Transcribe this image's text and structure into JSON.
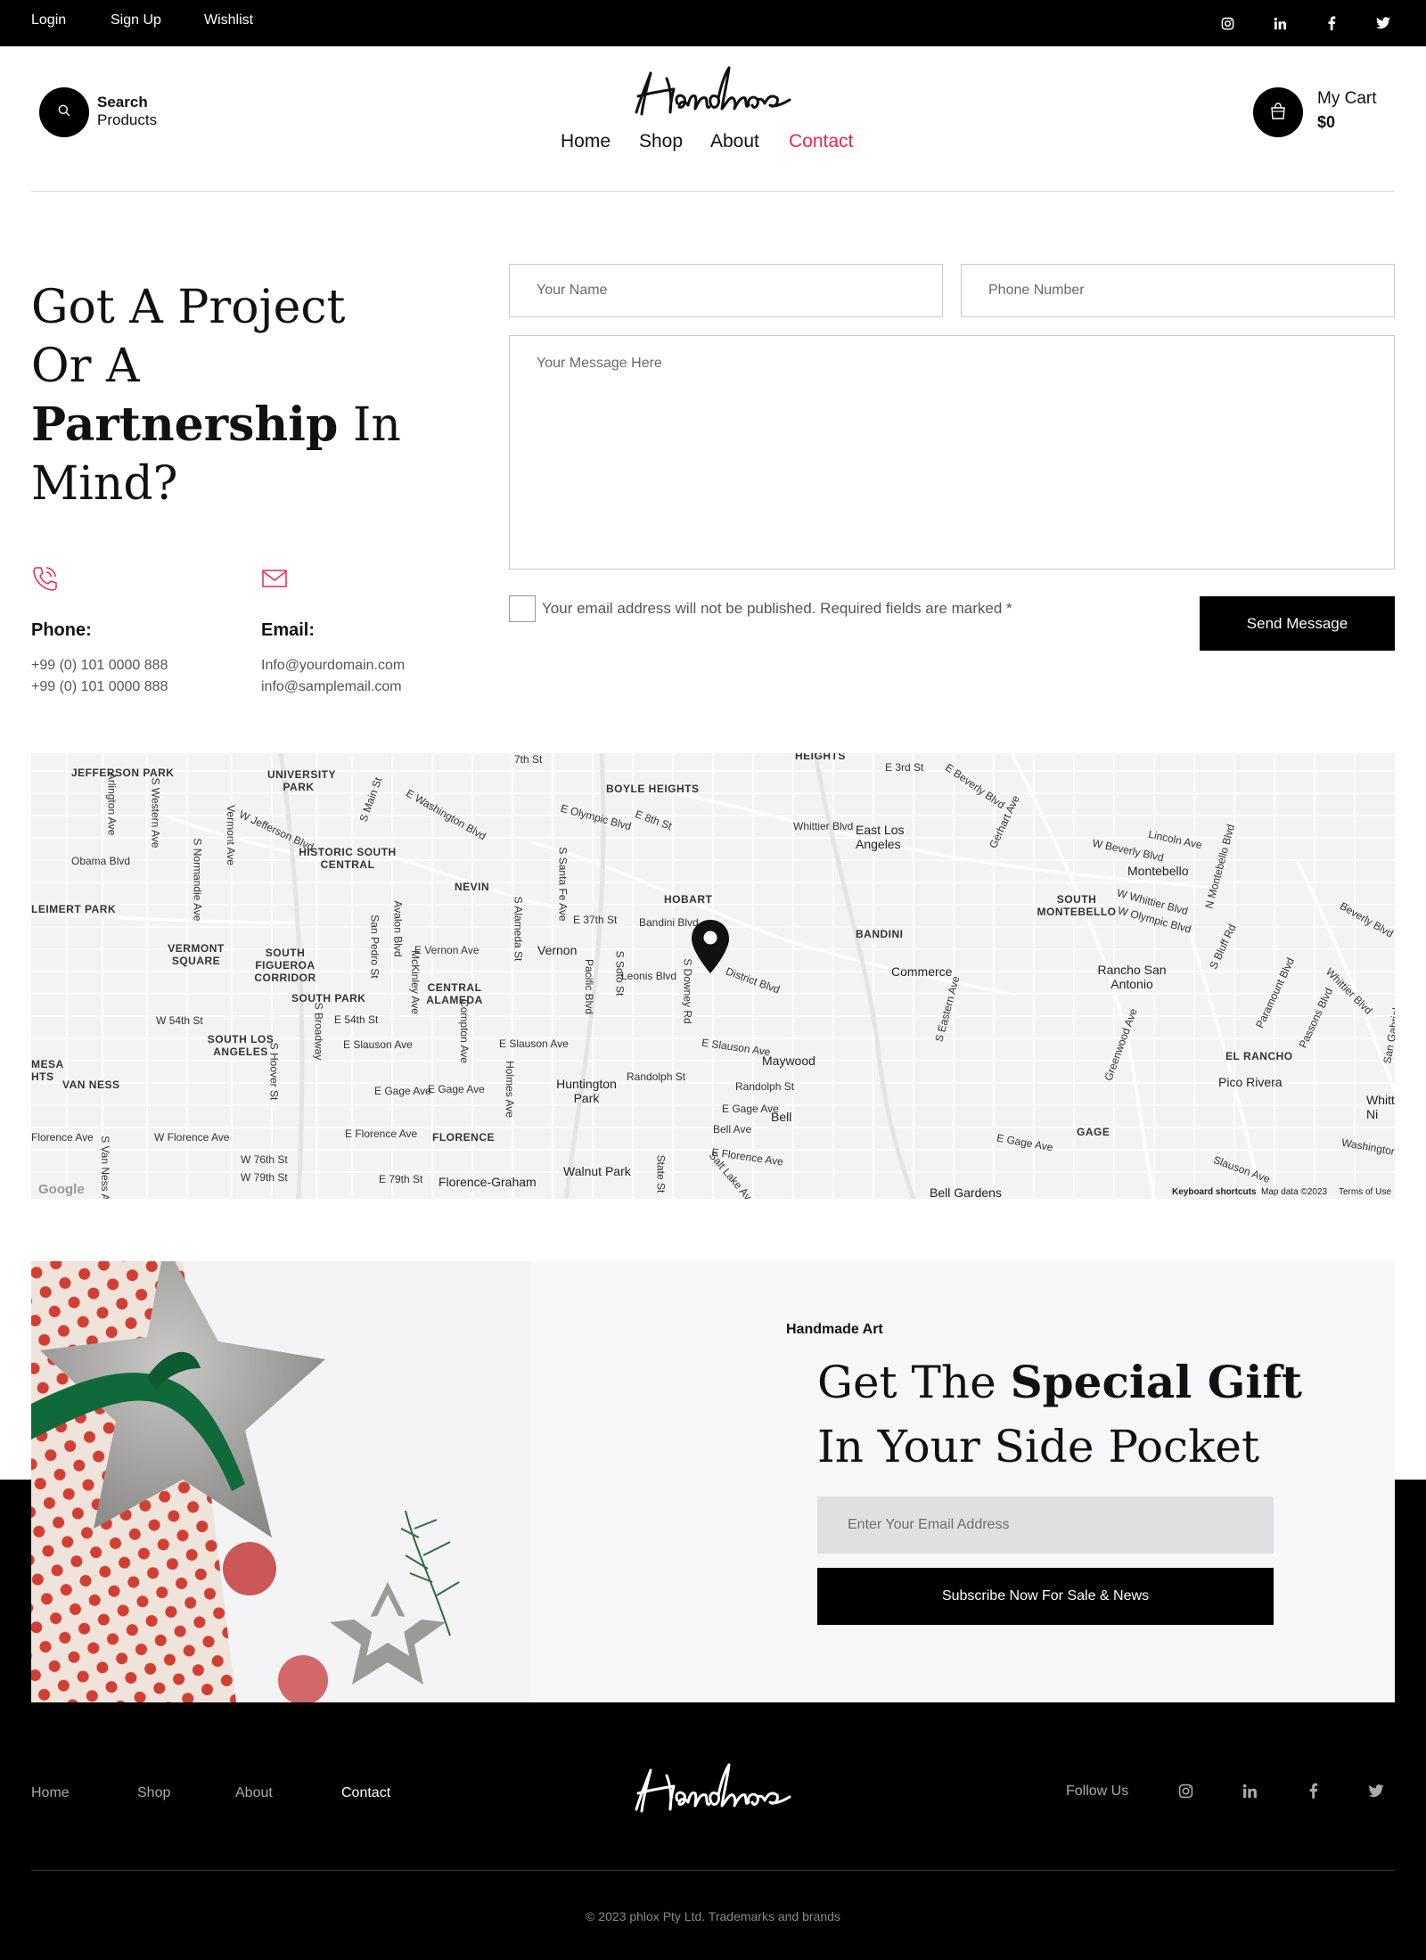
{
  "topbar": {
    "links": [
      "Login",
      "Sign Up",
      "Wishlist"
    ],
    "social_icons": [
      "instagram-icon",
      "linkedin-icon",
      "facebook-icon",
      "twitter-icon"
    ]
  },
  "header": {
    "search_label": "Search",
    "search_sublabel": "Products",
    "logo_text": "Handmade",
    "nav": [
      "Home",
      "Shop",
      "About",
      "Contact"
    ],
    "active_nav": "Contact",
    "cart_label": "My Cart",
    "cart_amount": "$0"
  },
  "contact": {
    "headline_line1": "Got A Project",
    "headline_line2": "Or A",
    "headline_bold": "Partnership",
    "headline_line3_rest": "In",
    "headline_line4": "Mind?",
    "phone_title": "Phone:",
    "phone_lines": [
      "+99 (0) 101 0000 888",
      "+99 (0) 101 0000 888"
    ],
    "email_title": "Email:",
    "email_lines": [
      "Info@yourdomain.com",
      "info@samplemail.com"
    ],
    "accent_color": "#e8294c"
  },
  "form": {
    "name_placeholder": "Your Name",
    "phone_placeholder": "Phone Number",
    "message_placeholder": "Your Message Here",
    "consent_text": "Your email address will not be published. Required fields are marked *",
    "consent_checked": false,
    "send_label": "Send Message"
  },
  "map": {
    "labels": {
      "jefferson_park": "JEFFERSON PARK",
      "university_park": "UNIVERSITY PARK",
      "boyle_heights": "BOYLE HEIGHTS",
      "heights": "HEIGHTS",
      "east_los_angeles": "East Los Angeles",
      "montebello": "Montebello",
      "south_montebello": "SOUTH MONTEBELLO",
      "historic_south_central": "HISTORIC SOUTH CENTRAL",
      "nevin": "NEVIN",
      "hobart": "HOBART",
      "bandini": "BANDINI",
      "leimert_park": "LEIMERT PARK",
      "vermont_square": "VERMONT SQUARE",
      "south_figueroa_corridor": "SOUTH FIGUEROA CORRIDOR",
      "vernon": "Vernon",
      "commerce": "Commerce",
      "rancho_san_antonio": "Rancho San Antonio",
      "central_alameda": "CENTRAL ALAMEDA",
      "south_park": "SOUTH PARK",
      "south_los_angeles": "SOUTH LOS ANGELES",
      "mesa_heights": "MESA HTS",
      "van_ness": "VAN NESS",
      "maywood": "Maywood",
      "el_rancho": "EL RANCHO",
      "pico_rivera": "Pico Rivera",
      "huntington_park": "Huntington Park",
      "bell": "Bell",
      "gage": "GAGE",
      "florence": "FLORENCE",
      "walnut_park": "Walnut Park",
      "florence_graham": "Florence-Graham",
      "bell_gardens": "Bell Gardens",
      "whittier_abbr": "Whitt Ni",
      "streets": [
        "7th St",
        "E 3rd St",
        "E Olympic Blvd",
        "E 8th St",
        "Whittier Blvd",
        "E Beverly Blvd",
        "Lincoln Ave",
        "W Beverly Blvd",
        "E Washington Blvd",
        "W Jefferson Blvd",
        "Obama Blvd",
        "E 37th St",
        "Bandini Blvd",
        "E Vernon Ave",
        "Leonis Blvd",
        "District Blvd",
        "W 54th St",
        "E 54th St",
        "E Slauson Ave",
        "Randolph St",
        "E Gage Ave",
        "E Florence Ave",
        "W Florence Ave",
        "W 76th St",
        "W 79th St",
        "E 79th St",
        "Washington",
        "Slauson Ave",
        "Beverly Blvd",
        "Whittier Blvd",
        "Passons Blvd",
        "Paramount Blvd",
        "Greenwood Ave",
        "S Bluff Rd",
        "N Montebello Blvd",
        "W Whittier Blvd",
        "W Olympic Blvd",
        "S Eastern Ave",
        "Gerhart Ave",
        "S Western Ave",
        "S Normandie Ave",
        "Vermont Ave",
        "S Main St",
        "Avalon Blvd",
        "San Pedro St",
        "McKinley Ave",
        "Compton Ave",
        "S Alameda St",
        "S Santa Fe Ave",
        "Pacific Blvd",
        "S Soto St",
        "S Downey Rd",
        "S Broadway",
        "S Hoover St",
        "Holmes Ave",
        "State St",
        "Salt Lake Ave",
        "Arlington Ave",
        "Bell Ave",
        "Florence Ave",
        "S Van Ness Ave",
        "San Gabriel"
      ]
    },
    "footer": [
      "Keyboard shortcuts",
      "Map data ©2023",
      "Terms of Use"
    ],
    "watermark": "Google",
    "marker_icon": "map-pin-icon"
  },
  "promo": {
    "kicker": "Handmade Art",
    "title_line1_pre": "Get The",
    "title_line1_bold": "Special Gift",
    "title_line2": "In Your Side Pocket",
    "email_placeholder": "Enter Your Email Address",
    "subscribe_label": "Subscribe Now For Sale & News"
  },
  "footer": {
    "links": [
      "Home",
      "Shop",
      "About",
      "Contact"
    ],
    "active_link": "Contact",
    "logo_text": "Handmade",
    "follow_label": "Follow Us",
    "social_icons": [
      "instagram-icon",
      "linkedin-icon",
      "facebook-icon",
      "twitter-icon"
    ],
    "copyright": "© 2023 phlox Pty Ltd. Trademarks and brands"
  }
}
